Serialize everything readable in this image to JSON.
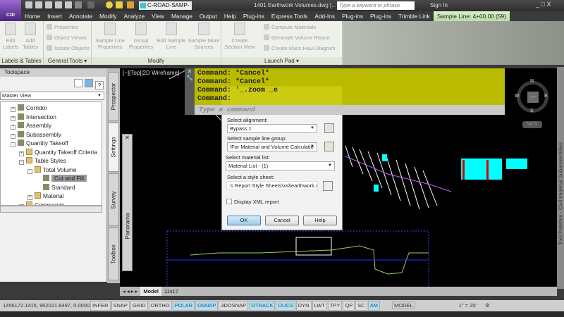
{
  "app": {
    "button_label": "C3D",
    "layer": "C-ROAD-SAMP-VOI",
    "document_title": "1401 Earthwork Volumes.dwg [...",
    "search_placeholder": "Type a keyword or phrase",
    "sign_in": "Sign In",
    "window_controls": "_ □ X"
  },
  "tabs": [
    "Home",
    "Insert",
    "Annotate",
    "Modify",
    "Analyze",
    "View",
    "Manage",
    "Output",
    "Help",
    "Plug-ins",
    "Express Tools",
    "Add-Ins",
    "Plug-ins",
    "Plug-ins",
    "Trimble Link",
    "Sample Line: 4+00.00 (59)"
  ],
  "active_tab_index": 15,
  "ribbon": {
    "labels_tables": {
      "label": "Labels & Tables",
      "edit_labels": "Edit Labels",
      "add_tables": "Add Tables"
    },
    "general_tools": {
      "label": "General Tools ▾",
      "properties": "Properties",
      "object_viewer": "Object Viewer",
      "isolate_objects": "Isolate Objects"
    },
    "modify": {
      "label": "Modify",
      "sample_line_properties": "Sample Line Properties",
      "group_properties": "Group Properties",
      "edit_sample_line": "Edit Sample Line",
      "sample_more_sources": "Sample More Sources"
    },
    "launch_pad": {
      "label": "Launch Pad ▾",
      "create_section_view": "Create Section View",
      "compute_materials": "Compute Materials",
      "generate_volume_report": "Generate Volume Report",
      "create_mass_haul_diagram": "Create Mass Haul Diagram"
    }
  },
  "toolspace": {
    "title": "Toolspace",
    "view": "Master View",
    "tree": [
      {
        "label": "Corridor",
        "level": 0,
        "expander": "+"
      },
      {
        "label": "Intersection",
        "level": 0,
        "expander": "+"
      },
      {
        "label": "Assembly",
        "level": 0,
        "expander": "+"
      },
      {
        "label": "Subassembly",
        "level": 0,
        "expander": "+"
      },
      {
        "label": "Quantity Takeoff",
        "level": 0,
        "expander": "-"
      },
      {
        "label": "Quantity Takeoff Criteria",
        "level": 1,
        "expander": "+"
      },
      {
        "label": "Table Styles",
        "level": 1,
        "expander": "-"
      },
      {
        "label": "Total Volume",
        "level": 2,
        "expander": "-"
      },
      {
        "label": "Cut and Fill",
        "level": 3,
        "expander": "",
        "selected": true
      },
      {
        "label": "Standard",
        "level": 3,
        "expander": ""
      },
      {
        "label": "Material",
        "level": 2,
        "expander": "+"
      },
      {
        "label": "Commands",
        "level": 1,
        "expander": "+"
      }
    ],
    "vertical_tabs": [
      "Prospector",
      "Settings",
      "Survey",
      "Toolbox"
    ],
    "active_vertical_tab": "Settings"
  },
  "viewport": {
    "label": "[−][Top][2D Wireframe]",
    "compass": {
      "n": "N",
      "s": "S",
      "e": "E",
      "w": "W",
      "top": "TOP"
    },
    "wcs": "WCS"
  },
  "command": {
    "history": [
      "Command: *Cancel*",
      "Command: *Cancel*",
      "Command: '_.zoom _e",
      "Command:"
    ],
    "placeholder": "Type a command"
  },
  "dialog": {
    "alignment_label": "Select alignment:",
    "alignment_value": "Bypass 1",
    "group_label": "Select sample line group:",
    "group_value": "!For Material and Volume Calculatio",
    "material_label": "Select material list:",
    "material_value": "Material List - (1)",
    "stylesheet_label": "Select a style sheet:",
    "stylesheet_value": ":s Report Style Sheets\\xsl\\earthwork.xsl",
    "xml_checkbox": "Display XML report",
    "xml_checked": false,
    "ok": "OK",
    "cancel": "Cancel",
    "help": "Help"
  },
  "panorama": "Panorama",
  "right_palette": "Tool Palettes - Civil Imperial Subassemblies",
  "layout_tabs": [
    "Model",
    "11x17"
  ],
  "status": {
    "coords": "1456172.1415, 902021.8497, 0.0000",
    "toggles": [
      {
        "l": "INFER",
        "on": false
      },
      {
        "l": "SNAP",
        "on": false
      },
      {
        "l": "GRID",
        "on": false
      },
      {
        "l": "ORTHO",
        "on": false
      },
      {
        "l": "POLAR",
        "on": true
      },
      {
        "l": "OSNAP",
        "on": true
      },
      {
        "l": "3DOSNAP",
        "on": false
      },
      {
        "l": "OTRACK",
        "on": true
      },
      {
        "l": "DUCS",
        "on": true
      },
      {
        "l": "DYN",
        "on": false
      },
      {
        "l": "LWT",
        "on": false
      },
      {
        "l": "TPY",
        "on": false
      },
      {
        "l": "QP",
        "on": false
      },
      {
        "l": "SC",
        "on": false
      },
      {
        "l": "AM",
        "on": true
      }
    ],
    "space": "MODEL",
    "scale": "1\" = 20'"
  }
}
